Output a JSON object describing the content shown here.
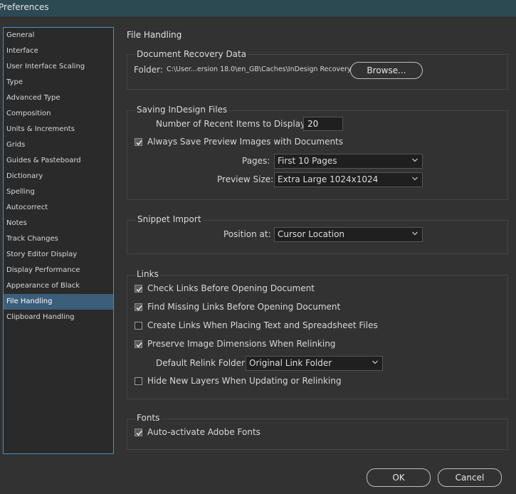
{
  "window": {
    "title": "Preferences"
  },
  "sidebar": {
    "items": [
      {
        "label": "General"
      },
      {
        "label": "Interface"
      },
      {
        "label": "User Interface Scaling"
      },
      {
        "label": "Type"
      },
      {
        "label": "Advanced Type"
      },
      {
        "label": "Composition"
      },
      {
        "label": "Units & Increments"
      },
      {
        "label": "Grids"
      },
      {
        "label": "Guides & Pasteboard"
      },
      {
        "label": "Dictionary"
      },
      {
        "label": "Spelling"
      },
      {
        "label": "Autocorrect"
      },
      {
        "label": "Notes"
      },
      {
        "label": "Track Changes"
      },
      {
        "label": "Story Editor Display"
      },
      {
        "label": "Display Performance"
      },
      {
        "label": "Appearance of Black"
      },
      {
        "label": "File Handling"
      },
      {
        "label": "Clipboard Handling"
      }
    ],
    "selected": "File Handling"
  },
  "main": {
    "title": "File Handling",
    "recovery": {
      "legend": "Document Recovery Data",
      "folder_label": "Folder:",
      "folder_path": "C:\\User...ersion 18.0\\en_GB\\Caches\\InDesign Recovery",
      "browse_label": "Browse..."
    },
    "saving": {
      "legend": "Saving InDesign Files",
      "recent_label": "Number of Recent Items to Display:",
      "recent_value": "20",
      "preview_checkbox_label": "Always Save Preview Images with Documents",
      "preview_checked": true,
      "pages_label": "Pages:",
      "pages_value": "First 10 Pages",
      "preview_size_label": "Preview Size:",
      "preview_size_value": "Extra Large 1024x1024"
    },
    "snippet": {
      "legend": "Snippet Import",
      "position_label": "Position at:",
      "position_value": "Cursor Location"
    },
    "links": {
      "legend": "Links",
      "check_links": {
        "label": "Check Links Before Opening Document",
        "checked": true
      },
      "find_missing": {
        "label": "Find Missing Links Before Opening Document",
        "checked": true
      },
      "create_links": {
        "label": "Create Links When Placing Text and Spreadsheet Files",
        "checked": false
      },
      "preserve_dims": {
        "label": "Preserve Image Dimensions When Relinking",
        "checked": true
      },
      "relink_label": "Default Relink Folder:",
      "relink_value": "Original Link Folder",
      "hide_layers": {
        "label": "Hide New Layers When Updating or Relinking",
        "checked": false
      }
    },
    "fonts": {
      "legend": "Fonts",
      "auto_activate": {
        "label": "Auto-activate Adobe Fonts",
        "checked": true
      }
    }
  },
  "footer": {
    "ok_label": "OK",
    "cancel_label": "Cancel"
  },
  "colors": {
    "accent": "#4a8fc4",
    "selected_bg": "#3b5e7a",
    "title_bg": "#2b4a52",
    "background": "#323232"
  }
}
